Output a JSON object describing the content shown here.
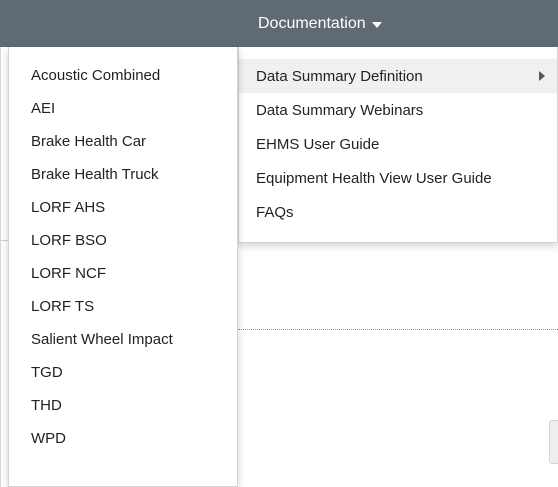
{
  "navbar": {
    "documentation_label": "Documentation"
  },
  "documentation_menu": {
    "items": [
      {
        "label": "Data Summary Definition",
        "has_submenu": true
      },
      {
        "label": "Data Summary Webinars"
      },
      {
        "label": "EHMS User Guide"
      },
      {
        "label": "Equipment Health View User Guide"
      },
      {
        "label": "FAQs"
      }
    ]
  },
  "data_summary_submenu": {
    "items": [
      {
        "label": "Acoustic Combined"
      },
      {
        "label": "AEI"
      },
      {
        "label": "Brake Health Car"
      },
      {
        "label": "Brake Health Truck"
      },
      {
        "label": "LORF AHS"
      },
      {
        "label": "LORF BSO"
      },
      {
        "label": "LORF NCF"
      },
      {
        "label": "LORF TS"
      },
      {
        "label": "Salient Wheel Impact"
      },
      {
        "label": "TGD"
      },
      {
        "label": "THD"
      },
      {
        "label": "WPD"
      }
    ]
  },
  "colors": {
    "navbar_bg": "#5f6a72",
    "active_item_bg": "#f0f0f0"
  }
}
